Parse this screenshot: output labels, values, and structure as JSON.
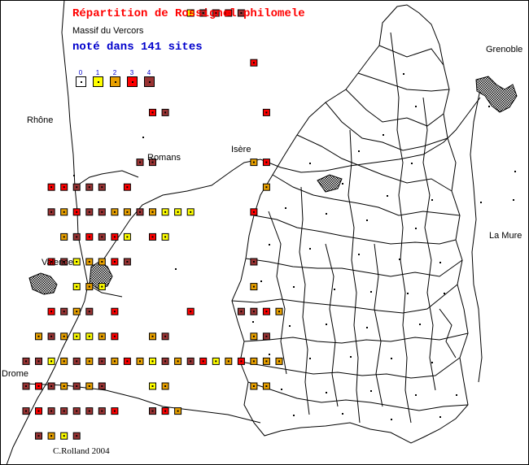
{
  "map": {
    "title": "Répartition de Rossignol philomele",
    "subtitle": "Massif du Vercors",
    "site_count_text": "noté dans 141 sites",
    "credit": "C.Rolland 2004"
  },
  "legend": [
    {
      "label": "0",
      "color": "#ffffff"
    },
    {
      "label": "1",
      "color": "#ffff00"
    },
    {
      "label": "2",
      "color": "#e8a000"
    },
    {
      "label": "3",
      "color": "#ff0000"
    },
    {
      "label": "4",
      "color": "#993333"
    }
  ],
  "places": {
    "grenoble": "Grenoble",
    "rhone": "Rhône",
    "romans": "Romans",
    "isere": "Isère",
    "valence": "Valence",
    "la_mure": "La Mure",
    "drome": "Drome"
  },
  "sites": [
    {
      "col": 13,
      "row": 0,
      "level": 1
    },
    {
      "col": 14,
      "row": 0,
      "level": 4
    },
    {
      "col": 15,
      "row": 0,
      "level": 4
    },
    {
      "col": 16,
      "row": 0,
      "level": 3
    },
    {
      "col": 17,
      "row": 0,
      "level": 4
    },
    {
      "col": 18,
      "row": 2,
      "level": 3
    },
    {
      "col": 10,
      "row": 4,
      "level": 3
    },
    {
      "col": 11,
      "row": 4,
      "level": 4
    },
    {
      "col": 19,
      "row": 4,
      "level": 3
    },
    {
      "col": 9,
      "row": 6,
      "level": 4
    },
    {
      "col": 10,
      "row": 6,
      "level": 4
    },
    {
      "col": 18,
      "row": 6,
      "level": 2
    },
    {
      "col": 19,
      "row": 6,
      "level": 3
    },
    {
      "col": 2,
      "row": 7,
      "level": 3
    },
    {
      "col": 3,
      "row": 7,
      "level": 3
    },
    {
      "col": 4,
      "row": 7,
      "level": 4
    },
    {
      "col": 5,
      "row": 7,
      "level": 4
    },
    {
      "col": 6,
      "row": 7,
      "level": 4
    },
    {
      "col": 8,
      "row": 7,
      "level": 3
    },
    {
      "col": 19,
      "row": 7,
      "level": 2
    },
    {
      "col": 2,
      "row": 8,
      "level": 4
    },
    {
      "col": 3,
      "row": 8,
      "level": 2
    },
    {
      "col": 4,
      "row": 8,
      "level": 3
    },
    {
      "col": 5,
      "row": 8,
      "level": 4
    },
    {
      "col": 6,
      "row": 8,
      "level": 4
    },
    {
      "col": 7,
      "row": 8,
      "level": 2
    },
    {
      "col": 8,
      "row": 8,
      "level": 2
    },
    {
      "col": 9,
      "row": 8,
      "level": 4
    },
    {
      "col": 10,
      "row": 8,
      "level": 2
    },
    {
      "col": 11,
      "row": 8,
      "level": 1
    },
    {
      "col": 12,
      "row": 8,
      "level": 1
    },
    {
      "col": 13,
      "row": 8,
      "level": 1
    },
    {
      "col": 18,
      "row": 8,
      "level": 3
    },
    {
      "col": 3,
      "row": 9,
      "level": 2
    },
    {
      "col": 4,
      "row": 9,
      "level": 4
    },
    {
      "col": 5,
      "row": 9,
      "level": 3
    },
    {
      "col": 6,
      "row": 9,
      "level": 4
    },
    {
      "col": 7,
      "row": 9,
      "level": 3
    },
    {
      "col": 8,
      "row": 9,
      "level": 1
    },
    {
      "col": 10,
      "row": 9,
      "level": 3
    },
    {
      "col": 11,
      "row": 9,
      "level": 1
    },
    {
      "col": 2,
      "row": 10,
      "level": 3
    },
    {
      "col": 3,
      "row": 10,
      "level": 4
    },
    {
      "col": 4,
      "row": 10,
      "level": 1
    },
    {
      "col": 5,
      "row": 10,
      "level": 2
    },
    {
      "col": 6,
      "row": 10,
      "level": 2
    },
    {
      "col": 7,
      "row": 10,
      "level": 3
    },
    {
      "col": 8,
      "row": 10,
      "level": 4
    },
    {
      "col": 18,
      "row": 10,
      "level": 4
    },
    {
      "col": 4,
      "row": 11,
      "level": 1
    },
    {
      "col": 5,
      "row": 11,
      "level": 2
    },
    {
      "col": 6,
      "row": 11,
      "level": 1
    },
    {
      "col": 18,
      "row": 11,
      "level": 2
    },
    {
      "col": 2,
      "row": 12,
      "level": 3
    },
    {
      "col": 3,
      "row": 12,
      "level": 4
    },
    {
      "col": 4,
      "row": 12,
      "level": 2
    },
    {
      "col": 5,
      "row": 12,
      "level": 4
    },
    {
      "col": 7,
      "row": 12,
      "level": 3
    },
    {
      "col": 13,
      "row": 12,
      "level": 3
    },
    {
      "col": 17,
      "row": 12,
      "level": 4
    },
    {
      "col": 18,
      "row": 12,
      "level": 4
    },
    {
      "col": 19,
      "row": 12,
      "level": 3
    },
    {
      "col": 20,
      "row": 12,
      "level": 2
    },
    {
      "col": 1,
      "row": 13,
      "level": 2
    },
    {
      "col": 2,
      "row": 13,
      "level": 4
    },
    {
      "col": 3,
      "row": 13,
      "level": 2
    },
    {
      "col": 4,
      "row": 13,
      "level": 1
    },
    {
      "col": 5,
      "row": 13,
      "level": 1
    },
    {
      "col": 6,
      "row": 13,
      "level": 2
    },
    {
      "col": 7,
      "row": 13,
      "level": 3
    },
    {
      "col": 10,
      "row": 13,
      "level": 2
    },
    {
      "col": 11,
      "row": 13,
      "level": 4
    },
    {
      "col": 18,
      "row": 13,
      "level": 2
    },
    {
      "col": 19,
      "row": 13,
      "level": 4
    },
    {
      "col": 0,
      "row": 14,
      "level": 4
    },
    {
      "col": 1,
      "row": 14,
      "level": 4
    },
    {
      "col": 2,
      "row": 14,
      "level": 1
    },
    {
      "col": 3,
      "row": 14,
      "level": 2
    },
    {
      "col": 4,
      "row": 14,
      "level": 4
    },
    {
      "col": 5,
      "row": 14,
      "level": 2
    },
    {
      "col": 6,
      "row": 14,
      "level": 4
    },
    {
      "col": 7,
      "row": 14,
      "level": 2
    },
    {
      "col": 8,
      "row": 14,
      "level": 3
    },
    {
      "col": 9,
      "row": 14,
      "level": 2
    },
    {
      "col": 10,
      "row": 14,
      "level": 1
    },
    {
      "col": 11,
      "row": 14,
      "level": 4
    },
    {
      "col": 12,
      "row": 14,
      "level": 2
    },
    {
      "col": 13,
      "row": 14,
      "level": 4
    },
    {
      "col": 14,
      "row": 14,
      "level": 3
    },
    {
      "col": 15,
      "row": 14,
      "level": 1
    },
    {
      "col": 16,
      "row": 14,
      "level": 2
    },
    {
      "col": 17,
      "row": 14,
      "level": 3
    },
    {
      "col": 18,
      "row": 14,
      "level": 2
    },
    {
      "col": 19,
      "row": 14,
      "level": 2
    },
    {
      "col": 20,
      "row": 14,
      "level": 2
    },
    {
      "col": 0,
      "row": 15,
      "level": 4
    },
    {
      "col": 1,
      "row": 15,
      "level": 3
    },
    {
      "col": 2,
      "row": 15,
      "level": 4
    },
    {
      "col": 3,
      "row": 15,
      "level": 2
    },
    {
      "col": 4,
      "row": 15,
      "level": 4
    },
    {
      "col": 5,
      "row": 15,
      "level": 2
    },
    {
      "col": 6,
      "row": 15,
      "level": 4
    },
    {
      "col": 10,
      "row": 15,
      "level": 1
    },
    {
      "col": 11,
      "row": 15,
      "level": 2
    },
    {
      "col": 18,
      "row": 15,
      "level": 2
    },
    {
      "col": 19,
      "row": 15,
      "level": 2
    },
    {
      "col": 0,
      "row": 16,
      "level": 4
    },
    {
      "col": 1,
      "row": 16,
      "level": 3
    },
    {
      "col": 2,
      "row": 16,
      "level": 4
    },
    {
      "col": 3,
      "row": 16,
      "level": 4
    },
    {
      "col": 4,
      "row": 16,
      "level": 4
    },
    {
      "col": 5,
      "row": 16,
      "level": 4
    },
    {
      "col": 6,
      "row": 16,
      "level": 4
    },
    {
      "col": 7,
      "row": 16,
      "level": 3
    },
    {
      "col": 10,
      "row": 16,
      "level": 4
    },
    {
      "col": 11,
      "row": 16,
      "level": 3
    },
    {
      "col": 12,
      "row": 16,
      "level": 2
    },
    {
      "col": 1,
      "row": 17,
      "level": 4
    },
    {
      "col": 2,
      "row": 17,
      "level": 2
    },
    {
      "col": 3,
      "row": 17,
      "level": 1
    },
    {
      "col": 4,
      "row": 17,
      "level": 4
    }
  ]
}
